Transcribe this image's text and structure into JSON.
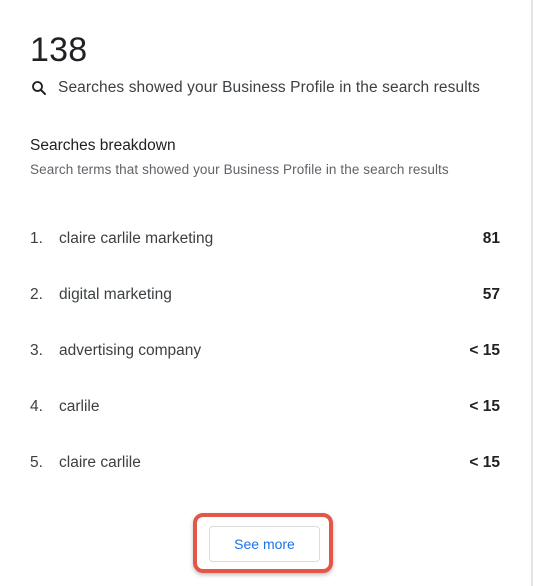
{
  "summary": {
    "total": "138",
    "icon": "search-icon",
    "description": "Searches showed your Business Profile in the search results"
  },
  "breakdown": {
    "title": "Searches breakdown",
    "subtitle": "Search terms that showed your Business Profile in the search results",
    "items": [
      {
        "rank": "1.",
        "term": "claire carlile marketing",
        "count": "81"
      },
      {
        "rank": "2.",
        "term": "digital marketing",
        "count": "57"
      },
      {
        "rank": "3.",
        "term": "advertising company",
        "count": "< 15"
      },
      {
        "rank": "4.",
        "term": "carlile",
        "count": "< 15"
      },
      {
        "rank": "5.",
        "term": "claire carlile",
        "count": "< 15"
      }
    ]
  },
  "actions": {
    "see_more_label": "See more"
  },
  "colors": {
    "accent": "#1a73e8",
    "highlight": "#e3574a"
  }
}
